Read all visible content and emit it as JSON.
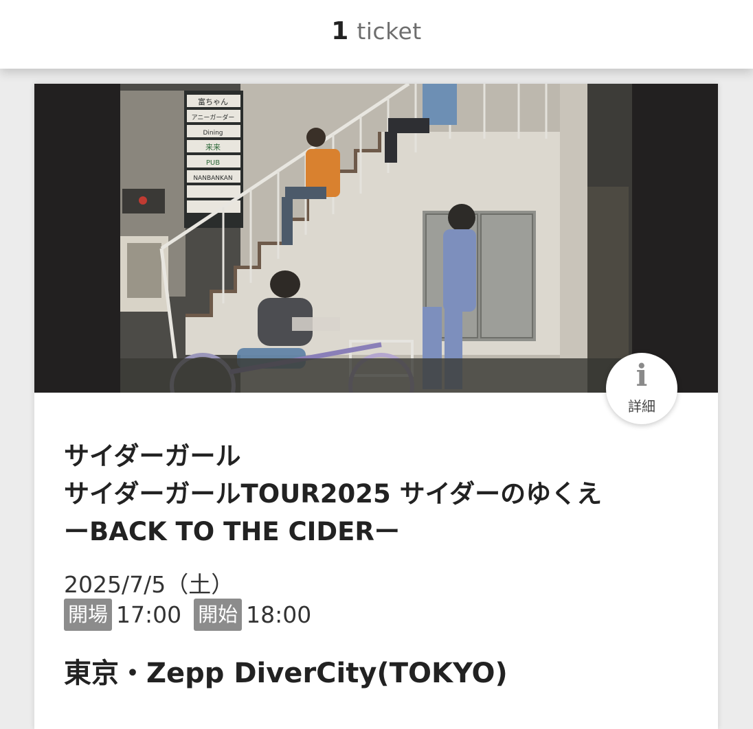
{
  "header": {
    "ticket_count": "1",
    "ticket_word": "ticket"
  },
  "event": {
    "artist": "サイダーガール",
    "tour_title": "サイダーガールTOUR2025 サイダーのゆくえ",
    "subtitle": "ーBACK TO THE CIDERー",
    "date": "2025/7/5（土）",
    "open_label": "開場",
    "open_time": "17:00",
    "start_label": "開始",
    "start_time": "18:00",
    "venue": "東京・Zepp DiverCity(TOKYO)"
  },
  "info_button": {
    "icon": "info-icon",
    "glyph": "i",
    "label": "詳細"
  },
  "photo_signs": [
    "富ちゃん",
    "アニーガーダー",
    "Dining",
    "来来",
    "PUB",
    "NANBANKAN"
  ],
  "colors": {
    "page_background": "#ececec",
    "tag_background": "#8c8c8c",
    "text_primary": "#222222",
    "text_muted": "#6e6e6e"
  }
}
